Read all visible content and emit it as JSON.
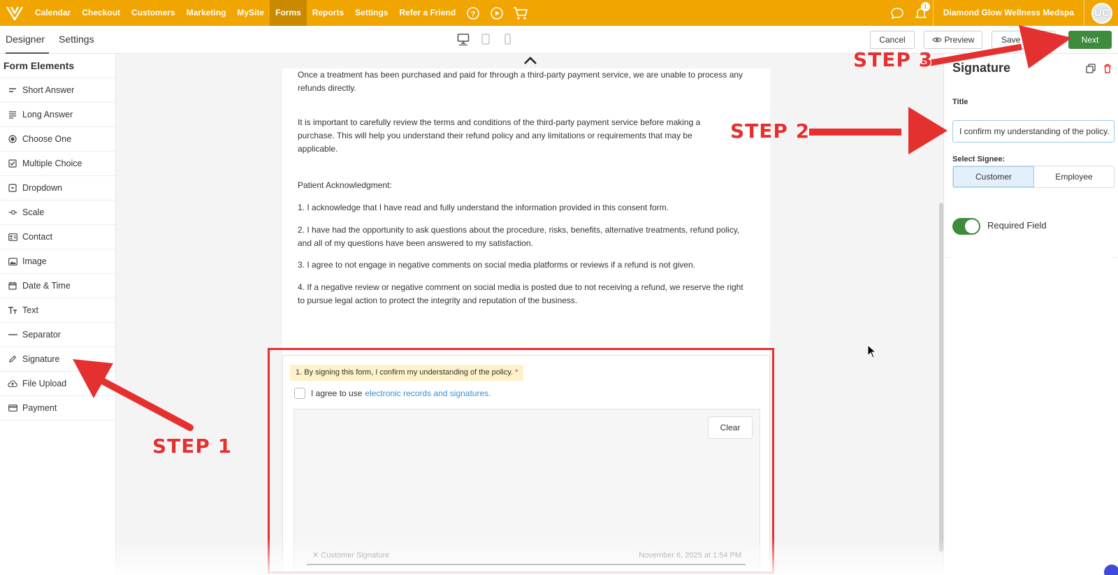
{
  "nav": {
    "items": [
      "Calendar",
      "Checkout",
      "Customers",
      "Marketing",
      "MySite",
      "Forms",
      "Reports",
      "Settings",
      "Refer a Friend"
    ],
    "active": "Forms",
    "business_name": "Diamond Glow Wellness Medspa",
    "notification_count": "1",
    "avatar_initials": "UC",
    "color": "#f0a500"
  },
  "subheader": {
    "tabs": [
      "Designer",
      "Settings"
    ],
    "cancel": "Cancel",
    "preview": "Preview",
    "save_as": "Save as",
    "next": "Next"
  },
  "left": {
    "title": "Form Elements",
    "items": [
      {
        "label": "Short Answer",
        "icon": "short-answer-icon"
      },
      {
        "label": "Long Answer",
        "icon": "long-answer-icon"
      },
      {
        "label": "Choose One",
        "icon": "radio-icon"
      },
      {
        "label": "Multiple Choice",
        "icon": "checkbox-icon"
      },
      {
        "label": "Dropdown",
        "icon": "dropdown-icon"
      },
      {
        "label": "Scale",
        "icon": "scale-icon"
      },
      {
        "label": "Contact",
        "icon": "contact-card-icon"
      },
      {
        "label": "Image",
        "icon": "image-icon"
      },
      {
        "label": "Date & Time",
        "icon": "calendar-icon"
      },
      {
        "label": "Text",
        "icon": "text-icon"
      },
      {
        "label": "Separator",
        "icon": "separator-icon"
      },
      {
        "label": "Signature",
        "icon": "pen-icon"
      },
      {
        "label": "File Upload",
        "icon": "cloud-upload-icon"
      },
      {
        "label": "Payment",
        "icon": "credit-card-icon"
      }
    ]
  },
  "doc": {
    "p1": "Once a treatment has been purchased and paid for through a third-party payment service, we are unable to process any refunds directly.",
    "p2": "It is important to carefully review the terms and conditions of the third-party payment service before making a purchase. This will help you understand their refund policy and any limitations or requirements that may be applicable.",
    "p3": "Patient Acknowledgment:",
    "p4": "1. I acknowledge that I have read and fully understand the information provided in this consent form.",
    "p5": "2. I have had the opportunity to ask questions about the procedure, risks, benefits, alternative treatments, refund policy, and all of my questions have been answered to my satisfaction.",
    "p6": "3. I agree to not engage in negative comments on social media platforms or reviews if a refund is not given.",
    "p7": "4. If a negative review or negative comment on social media is posted due to not receiving a refund, we reserve the right to pursue legal action to protect the integrity and reputation of the business."
  },
  "signature_card": {
    "label": "1. By signing this form, I confirm my understanding of the policy.",
    "required_mark": "*",
    "agree_text": "I agree to use",
    "agree_link": "electronic records and signatures.",
    "clear": "Clear",
    "caption": "Customer Signature",
    "date": "November 6, 2025 at 1:54 PM"
  },
  "right": {
    "title": "Signature",
    "title_label": "Title",
    "title_value": "I confirm my understanding of the policy.",
    "signee_label": "Select Signee:",
    "signee_options": [
      "Customer",
      "Employee"
    ],
    "signee_selected": "Customer",
    "required_label": "Required Field",
    "required_on": true
  },
  "annotations": {
    "step1": "STEP 1",
    "step2": "STEP 2",
    "step3": "STEP 3",
    "color": "#e53030"
  }
}
